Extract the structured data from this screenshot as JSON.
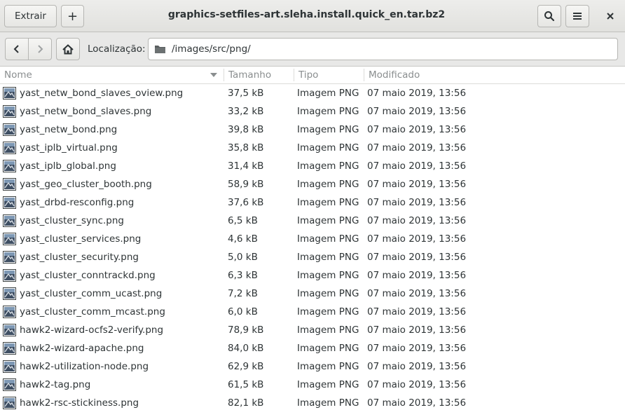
{
  "toolbar": {
    "extract_label": "Extrair",
    "add_label": "+",
    "title": "graphics-setfiles-art.sleha.install.quick_en.tar.bz2",
    "close_label": "×"
  },
  "location": {
    "label": "Localização:",
    "path": "/images/src/png/"
  },
  "columns": [
    "Nome",
    "Tamanho",
    "Tipo",
    "Modificado"
  ],
  "files": [
    {
      "name": "yast_netw_bond_slaves_oview.png",
      "size": "37,5 kB",
      "type": "Imagem PNG",
      "modified": "07 maio 2019, 13:56"
    },
    {
      "name": "yast_netw_bond_slaves.png",
      "size": "33,2 kB",
      "type": "Imagem PNG",
      "modified": "07 maio 2019, 13:56"
    },
    {
      "name": "yast_netw_bond.png",
      "size": "39,8 kB",
      "type": "Imagem PNG",
      "modified": "07 maio 2019, 13:56"
    },
    {
      "name": "yast_iplb_virtual.png",
      "size": "35,8 kB",
      "type": "Imagem PNG",
      "modified": "07 maio 2019, 13:56"
    },
    {
      "name": "yast_iplb_global.png",
      "size": "31,4 kB",
      "type": "Imagem PNG",
      "modified": "07 maio 2019, 13:56"
    },
    {
      "name": "yast_geo_cluster_booth.png",
      "size": "58,9 kB",
      "type": "Imagem PNG",
      "modified": "07 maio 2019, 13:56"
    },
    {
      "name": "yast_drbd-resconfig.png",
      "size": "37,6 kB",
      "type": "Imagem PNG",
      "modified": "07 maio 2019, 13:56"
    },
    {
      "name": "yast_cluster_sync.png",
      "size": "6,5 kB",
      "type": "Imagem PNG",
      "modified": "07 maio 2019, 13:56"
    },
    {
      "name": "yast_cluster_services.png",
      "size": "4,6 kB",
      "type": "Imagem PNG",
      "modified": "07 maio 2019, 13:56"
    },
    {
      "name": "yast_cluster_security.png",
      "size": "5,0 kB",
      "type": "Imagem PNG",
      "modified": "07 maio 2019, 13:56"
    },
    {
      "name": "yast_cluster_conntrackd.png",
      "size": "6,3 kB",
      "type": "Imagem PNG",
      "modified": "07 maio 2019, 13:56"
    },
    {
      "name": "yast_cluster_comm_ucast.png",
      "size": "7,2 kB",
      "type": "Imagem PNG",
      "modified": "07 maio 2019, 13:56"
    },
    {
      "name": "yast_cluster_comm_mcast.png",
      "size": "6,0 kB",
      "type": "Imagem PNG",
      "modified": "07 maio 2019, 13:56"
    },
    {
      "name": "hawk2-wizard-ocfs2-verify.png",
      "size": "78,9 kB",
      "type": "Imagem PNG",
      "modified": "07 maio 2019, 13:56"
    },
    {
      "name": "hawk2-wizard-apache.png",
      "size": "84,0 kB",
      "type": "Imagem PNG",
      "modified": "07 maio 2019, 13:56"
    },
    {
      "name": "hawk2-utilization-node.png",
      "size": "62,9 kB",
      "type": "Imagem PNG",
      "modified": "07 maio 2019, 13:56"
    },
    {
      "name": "hawk2-tag.png",
      "size": "61,5 kB",
      "type": "Imagem PNG",
      "modified": "07 maio 2019, 13:56"
    },
    {
      "name": "hawk2-rsc-stickiness.png",
      "size": "82,1 kB",
      "type": "Imagem PNG",
      "modified": "07 maio 2019, 13:56"
    }
  ],
  "icons": {
    "file": "image-file-icon",
    "folder": "folder-icon",
    "home": "home-icon",
    "back": "chevron-left-icon",
    "forward": "chevron-right-icon",
    "search": "search-icon",
    "menu": "hamburger-menu-icon",
    "sort": "sort-descending-icon"
  }
}
